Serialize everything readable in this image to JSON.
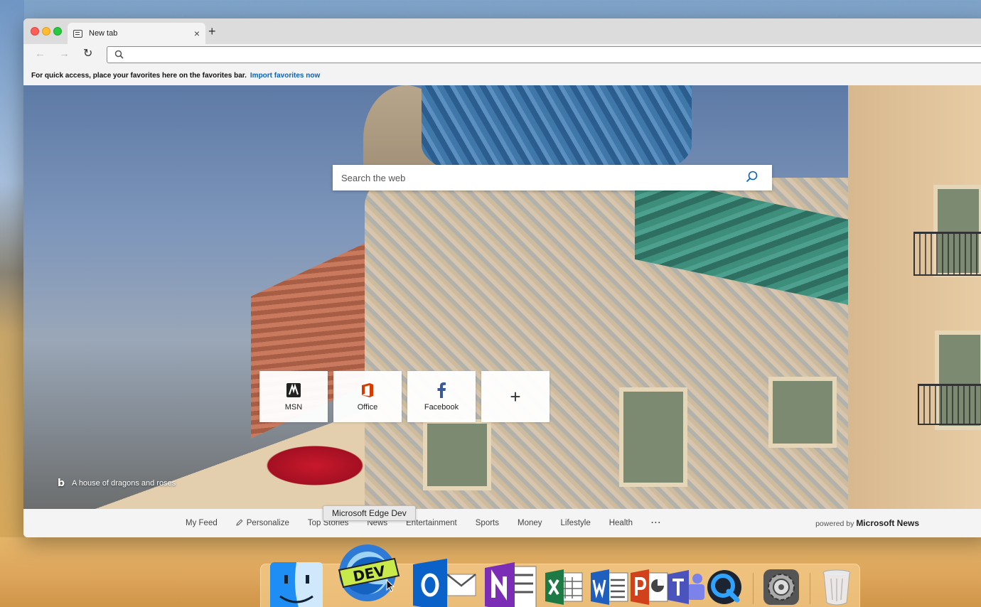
{
  "browser": {
    "tab": {
      "title": "New tab",
      "close": "×",
      "icon": "newtab-page-icon"
    },
    "new_tab_button": "+",
    "toolbar": {
      "back": "←",
      "forward": "→",
      "reload": "↻"
    },
    "address_bar": {
      "value": "",
      "placeholder": ""
    },
    "favorites_bar": {
      "text": "For quick access, place your favorites here on the favorites bar.",
      "link": "Import favorites now"
    }
  },
  "new_tab_page": {
    "search": {
      "placeholder": "Search the web"
    },
    "quick_links": [
      {
        "label": "MSN",
        "icon": "msn-icon"
      },
      {
        "label": "Office",
        "icon": "office-icon"
      },
      {
        "label": "Facebook",
        "icon": "facebook-icon"
      }
    ],
    "add_tile": "+",
    "image_caption": "A house of dragons and roses",
    "news_nav": [
      "My Feed",
      "Personalize",
      "Top Stories",
      "News",
      "Entertainment",
      "Sports",
      "Money",
      "Lifestyle",
      "Health"
    ],
    "news_more": "···",
    "powered_by": {
      "prefix": "powered by",
      "brand": "Microsoft News"
    }
  },
  "tooltip": "Microsoft Edge Dev",
  "dock": {
    "apps": [
      {
        "name": "Finder",
        "icon": "finder-icon"
      },
      {
        "name": "Microsoft Edge Dev",
        "icon": "edge-dev-icon",
        "badge": "DEV"
      },
      {
        "name": "Outlook",
        "icon": "outlook-icon"
      },
      {
        "name": "OneNote",
        "icon": "onenote-icon"
      },
      {
        "name": "Excel",
        "icon": "excel-icon"
      },
      {
        "name": "Word",
        "icon": "word-icon"
      },
      {
        "name": "PowerPoint",
        "icon": "powerpoint-icon"
      },
      {
        "name": "Teams",
        "icon": "teams-icon"
      },
      {
        "name": "QuickTime",
        "icon": "quicktime-icon"
      },
      {
        "name": "System Preferences",
        "icon": "system-preferences-icon"
      },
      {
        "name": "Trash",
        "icon": "trash-icon"
      }
    ]
  },
  "colors": {
    "accent_link": "#0a63b8",
    "office_red": "#d83b01",
    "facebook_blue": "#3b5998"
  }
}
